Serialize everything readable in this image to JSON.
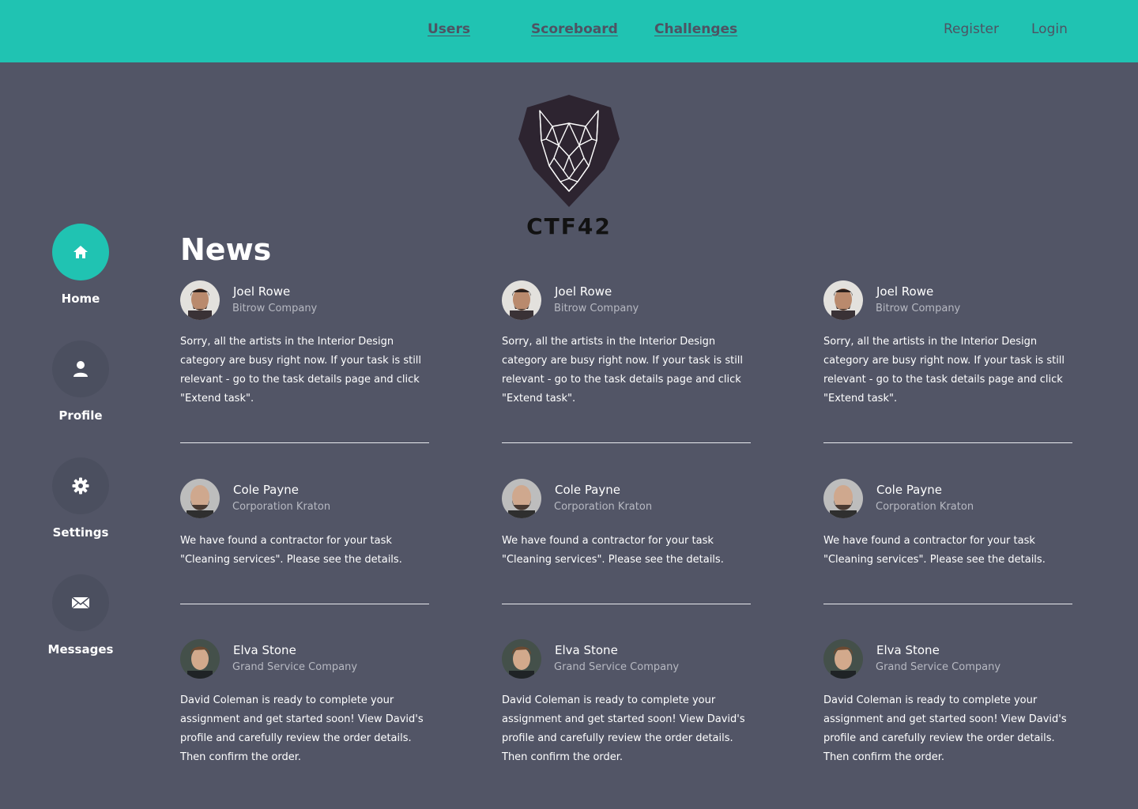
{
  "nav": {
    "users": "Users",
    "scoreboard": "Scoreboard",
    "challenges": "Challenges",
    "register": "Register",
    "login": "Login"
  },
  "logo": {
    "text": "CTF42",
    "icon": "wolf-shield-logo"
  },
  "sidebar": {
    "items": [
      {
        "label": "Home",
        "icon": "home-icon",
        "active": true
      },
      {
        "label": "Profile",
        "icon": "user-icon",
        "active": false
      },
      {
        "label": "Settings",
        "icon": "gear-icon",
        "active": false
      },
      {
        "label": "Messages",
        "icon": "envelope-icon",
        "active": false
      }
    ]
  },
  "news": {
    "title": "News",
    "rows": [
      {
        "author": "Joel Rowe",
        "company": "Bitrow Company",
        "message": "Sorry, all the artists in the Interior Design category are busy right now. If your task is still relevant - go to the task details page and click \"Extend task\"."
      },
      {
        "author": "Cole Payne",
        "company": "Corporation Kraton",
        "message": "We have found a contractor for your task \"Cleaning services\". Please see the details."
      },
      {
        "author": "Elva Stone",
        "company": "Grand Service Company",
        "message": "David Coleman is ready to complete your assignment and get started soon! View David's profile and carefully review the order details. Then confirm the order."
      }
    ]
  },
  "colors": {
    "accent": "#20c3b2",
    "background": "#525566",
    "nav_text": "#4e5363",
    "sidebar_button": "#4b4f5f",
    "muted_text": "#b7b9c2"
  }
}
